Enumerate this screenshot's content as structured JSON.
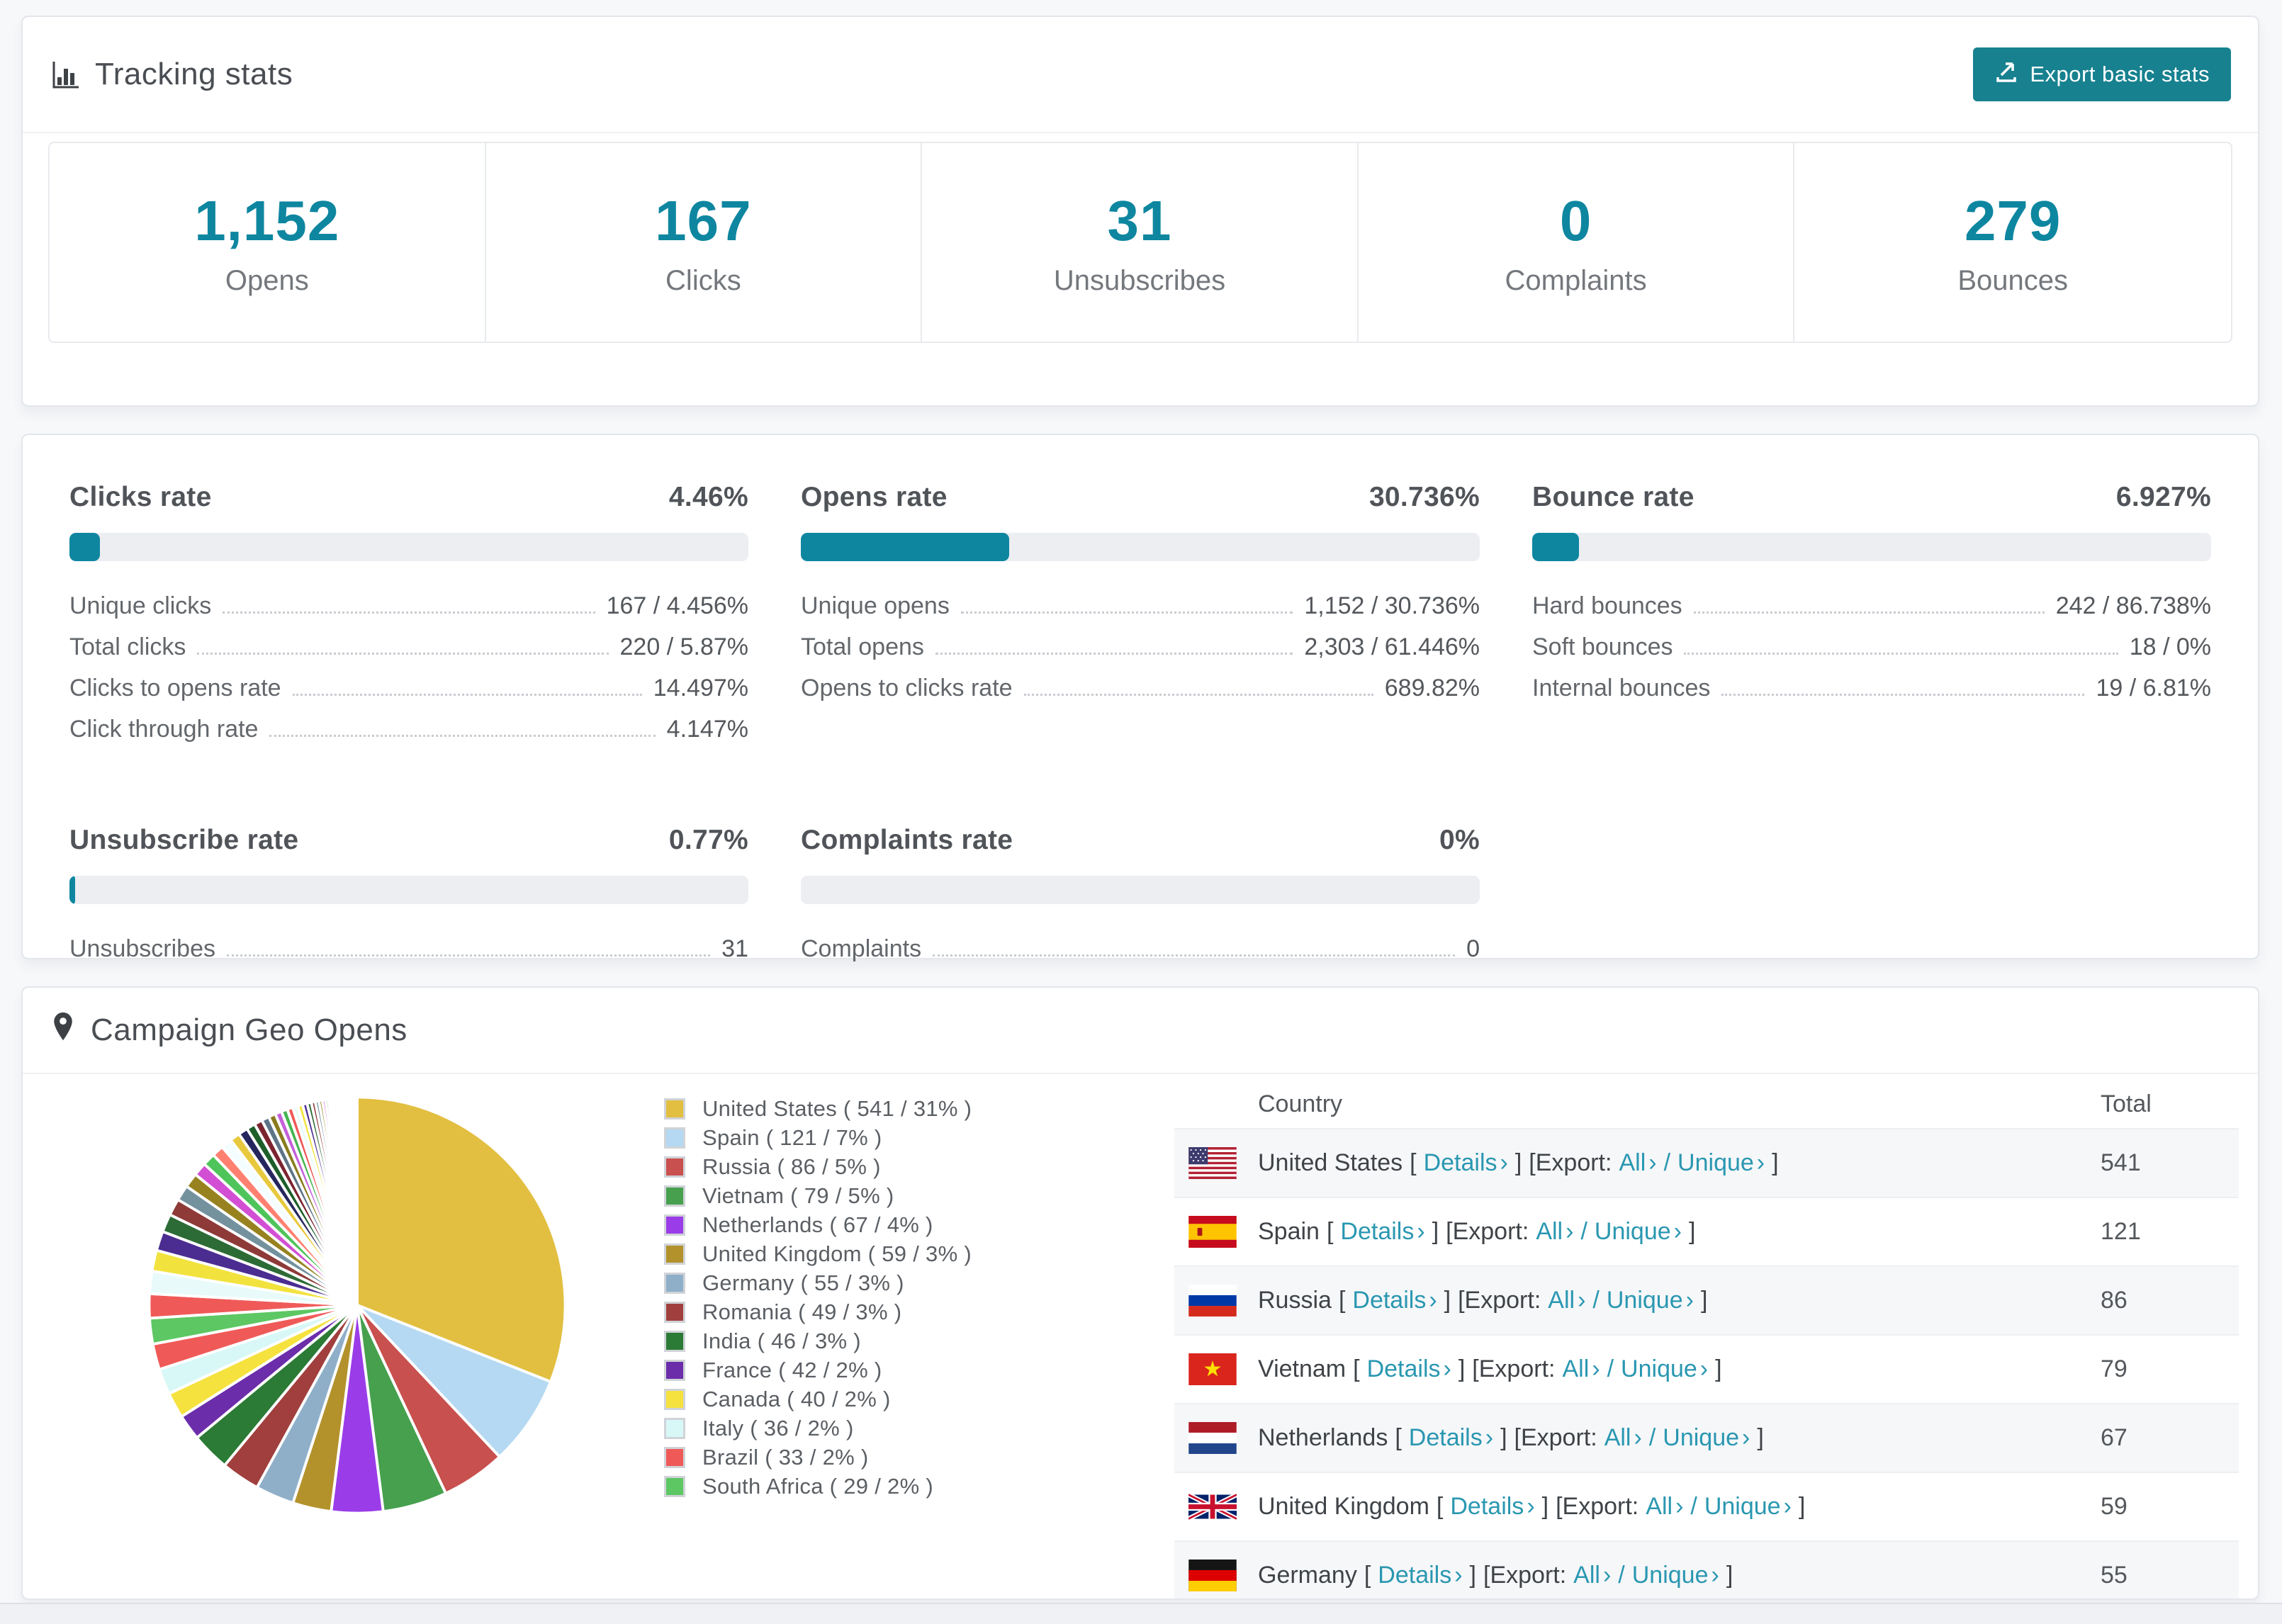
{
  "colors": {
    "accent": "#0e86a0",
    "button": "#17818f",
    "link": "#2a97b1",
    "bar_track": "#eceef2"
  },
  "header": {
    "title": "Tracking stats",
    "export_label": "Export basic stats"
  },
  "summary": [
    {
      "value": "1,152",
      "label": "Opens"
    },
    {
      "value": "167",
      "label": "Clicks"
    },
    {
      "value": "31",
      "label": "Unsubscribes"
    },
    {
      "value": "0",
      "label": "Complaints"
    },
    {
      "value": "279",
      "label": "Bounces"
    }
  ],
  "rate_blocks": [
    {
      "title": "Clicks rate",
      "percent": "4.46%",
      "fill_percent": 4.46,
      "rows": [
        {
          "label": "Unique clicks",
          "value": "167 / 4.456%"
        },
        {
          "label": "Total clicks",
          "value": "220 / 5.87%"
        },
        {
          "label": "Clicks to opens rate",
          "value": "14.497%"
        },
        {
          "label": "Click through rate",
          "value": "4.147%"
        }
      ]
    },
    {
      "title": "Opens rate",
      "percent": "30.736%",
      "fill_percent": 30.736,
      "rows": [
        {
          "label": "Unique opens",
          "value": "1,152 / 30.736%"
        },
        {
          "label": "Total opens",
          "value": "2,303 / 61.446%"
        },
        {
          "label": "Opens to clicks rate",
          "value": "689.82%"
        }
      ]
    },
    {
      "title": "Bounce rate",
      "percent": "6.927%",
      "fill_percent": 6.927,
      "rows": [
        {
          "label": "Hard bounces",
          "value": "242 / 86.738%"
        },
        {
          "label": "Soft bounces",
          "value": "18 / 0%"
        },
        {
          "label": "Internal bounces",
          "value": "19 / 6.81%"
        }
      ]
    },
    {
      "title": "Unsubscribe rate",
      "percent": "0.77%",
      "fill_percent": 0.77,
      "rows": [
        {
          "label": "Unsubscribes",
          "value": "31"
        }
      ]
    },
    {
      "title": "Complaints rate",
      "percent": "0%",
      "fill_percent": 0,
      "rows": [
        {
          "label": "Complaints",
          "value": "0"
        }
      ]
    }
  ],
  "geo": {
    "title": "Campaign Geo Opens",
    "links": {
      "details": "Details",
      "export": "Export:",
      "all": "All",
      "unique": "Unique",
      "chevron": "›",
      "slash": "/",
      "open_bracket": "[",
      "close_bracket": "]"
    },
    "table": {
      "col_country": "Country",
      "col_total": "Total",
      "rows": [
        {
          "country": "United States",
          "total": "541",
          "flag": "us"
        },
        {
          "country": "Spain",
          "total": "121",
          "flag": "es"
        },
        {
          "country": "Russia",
          "total": "86",
          "flag": "ru"
        },
        {
          "country": "Vietnam",
          "total": "79",
          "flag": "vn"
        },
        {
          "country": "Netherlands",
          "total": "67",
          "flag": "nl"
        },
        {
          "country": "United Kingdom",
          "total": "59",
          "flag": "gb"
        },
        {
          "country": "Germany",
          "total": "55",
          "flag": "de"
        }
      ]
    }
  },
  "chart_data": {
    "type": "pie",
    "title": "Campaign Geo Opens",
    "legend_position": "right",
    "start_angle_deg": -90,
    "series": [
      {
        "name": "United States",
        "value": 541,
        "percent": 31,
        "color": "#e2bf41",
        "label": "United States ( 541 / 31% )"
      },
      {
        "name": "Spain",
        "value": 121,
        "percent": 7,
        "color": "#b5d9f2",
        "label": "Spain ( 121 / 7% )"
      },
      {
        "name": "Russia",
        "value": 86,
        "percent": 5,
        "color": "#c8504e",
        "label": "Russia ( 86 / 5% )"
      },
      {
        "name": "Vietnam",
        "value": 79,
        "percent": 5,
        "color": "#46a04e",
        "label": "Vietnam ( 79 / 5% )"
      },
      {
        "name": "Netherlands",
        "value": 67,
        "percent": 4,
        "color": "#9a3de8",
        "label": "Netherlands ( 67 / 4% )"
      },
      {
        "name": "United Kingdom",
        "value": 59,
        "percent": 3,
        "color": "#b3922c",
        "label": "United Kingdom ( 59 / 3% )"
      },
      {
        "name": "Germany",
        "value": 55,
        "percent": 3,
        "color": "#8fafc9",
        "label": "Germany ( 55 / 3% )"
      },
      {
        "name": "Romania",
        "value": 49,
        "percent": 3,
        "color": "#a03f3d",
        "label": "Romania ( 49 / 3% )"
      },
      {
        "name": "India",
        "value": 46,
        "percent": 3,
        "color": "#2b7a35",
        "label": "India ( 46 / 3% )"
      },
      {
        "name": "France",
        "value": 42,
        "percent": 2,
        "color": "#6b2daa",
        "label": "France ( 42 / 2% )"
      },
      {
        "name": "Canada",
        "value": 40,
        "percent": 2,
        "color": "#f5e23f",
        "label": "Canada ( 40 / 2% )"
      },
      {
        "name": "Italy",
        "value": 36,
        "percent": 2,
        "color": "#d8f8f7",
        "label": "Italy ( 36 / 2% )"
      },
      {
        "name": "Brazil",
        "value": 33,
        "percent": 2,
        "color": "#ef5a58",
        "label": "Brazil ( 33 / 2% )"
      },
      {
        "name": "South Africa",
        "value": 29,
        "percent": 2,
        "color": "#5dc763",
        "label": "South Africa ( 29 / 2% )"
      }
    ],
    "others": {
      "percent_total": 26,
      "slice_count": 48,
      "decay": 0.93,
      "palette": [
        "#ef5a58",
        "#e8fbfa",
        "#f2e23e",
        "#4b2d91",
        "#2d6b36",
        "#8e3a38",
        "#74919e",
        "#97821f",
        "#d24fd4",
        "#4fc45a",
        "#ff8070",
        "#f4fdff",
        "#e8c93e",
        "#26265e",
        "#1d5e2a",
        "#7c2430",
        "#5e7488",
        "#8a7c1d",
        "#c45fd9",
        "#44b44f"
      ]
    }
  }
}
